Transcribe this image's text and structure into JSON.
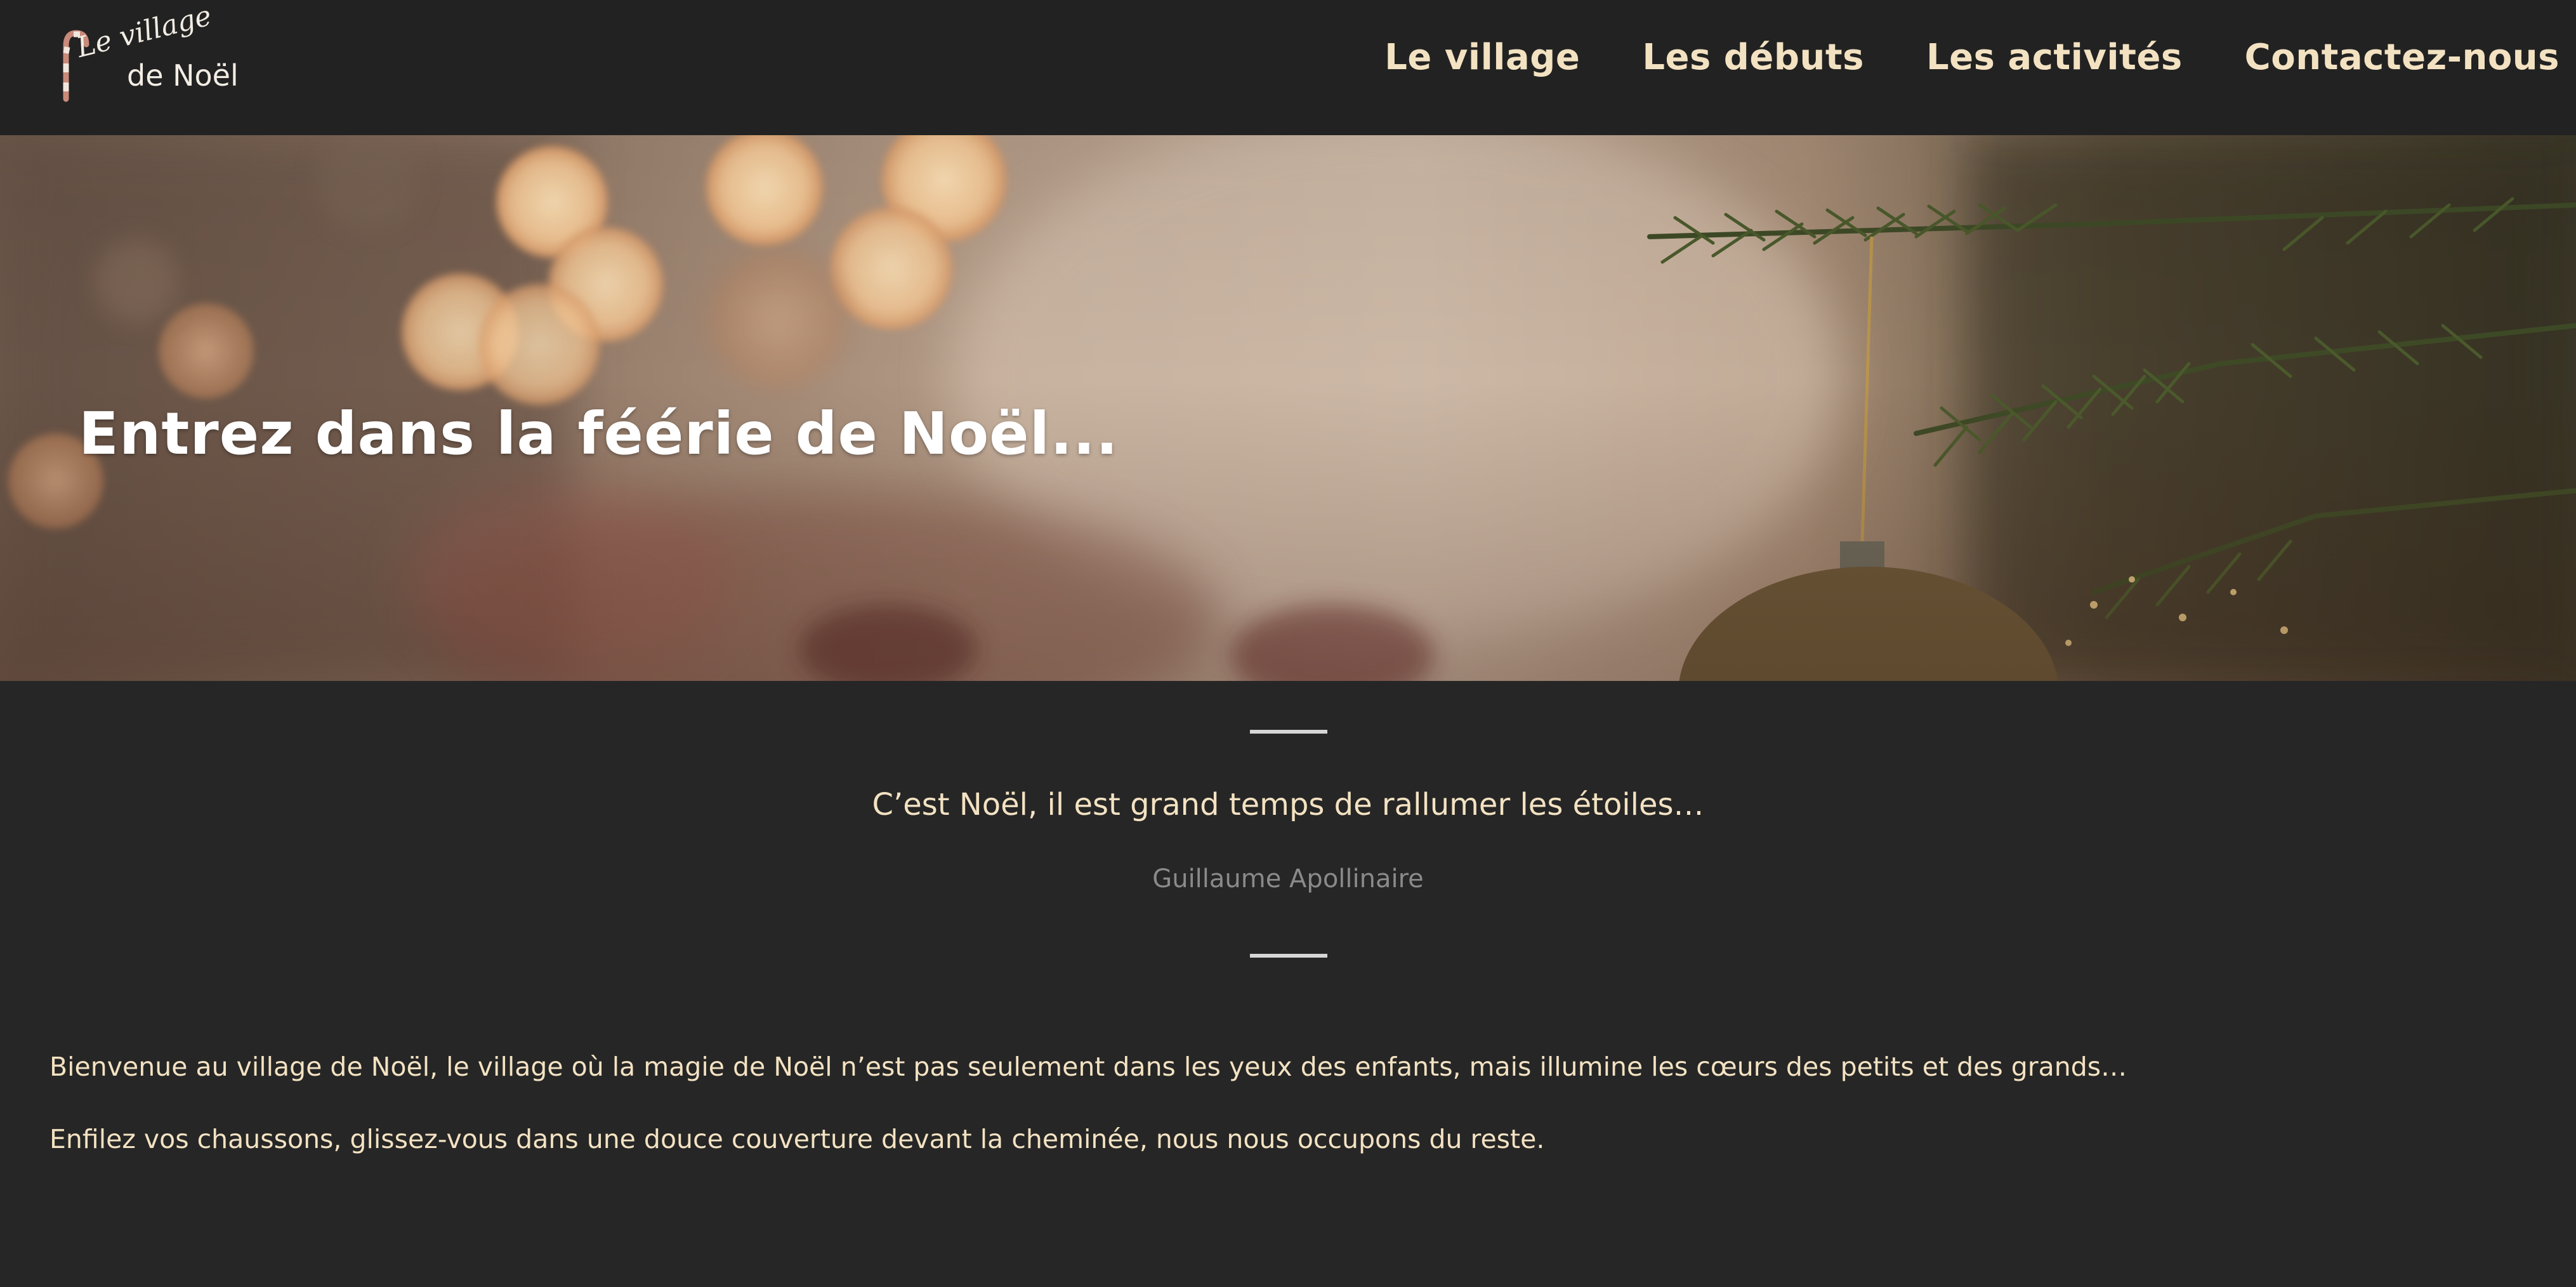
{
  "logo": {
    "line1": "Le village",
    "line2": "de Noël",
    "icon": "candy-cane-icon"
  },
  "nav": {
    "items": [
      {
        "label": "Le village"
      },
      {
        "label": "Les débuts"
      },
      {
        "label": "Les activités"
      },
      {
        "label": "Contactez-nous"
      }
    ]
  },
  "hero": {
    "title": "Entrez dans la féérie de Noël..."
  },
  "quote": {
    "text": "C’est Noël, il est grand temps de rallumer les étoiles…",
    "author": "Guillaume Apollinaire"
  },
  "intro": {
    "paragraph1": "Bienvenue au village de Noël, le village où la magie de Noël n’est pas seulement dans les yeux des enfants, mais illumine les cœurs des petits et des grands…",
    "paragraph2": "Enfilez vos chaussons, glissez-vous dans une douce couverture devant la cheminée, nous nous occupons du reste."
  },
  "colors": {
    "header_bg": "#222222",
    "page_bg": "#262626",
    "accent_text": "#f3e2c2",
    "muted_text": "#8a8a8a"
  }
}
